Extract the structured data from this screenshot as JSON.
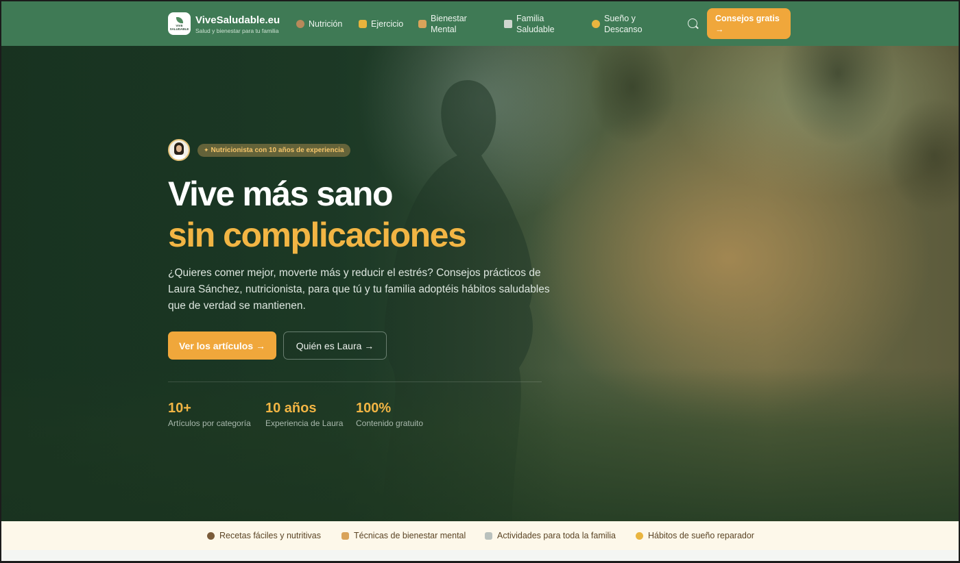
{
  "header": {
    "logo_text": "VIVE SALUDABLE",
    "brand_name": "ViveSaludable.eu",
    "brand_tagline": "Salud y bienestar para tu familia",
    "nav": [
      {
        "label": "Nutrición",
        "icon": "bowl-icon"
      },
      {
        "label": "Ejercicio",
        "icon": "flexed-arm-icon"
      },
      {
        "label": "Bienestar Mental",
        "icon": "meditation-icon"
      },
      {
        "label": "Familia Saludable",
        "icon": "family-icon"
      },
      {
        "label": "Sueño y Descanso",
        "icon": "sleeping-face-icon"
      }
    ],
    "cta_label": "Consejos gratis →"
  },
  "hero": {
    "badge": "Nutricionista con 10 años de experiencia",
    "title_line1": "Vive más sano",
    "title_line2": "sin complicaciones",
    "lead": "¿Quieres comer mejor, moverte más y reducir el estrés? Consejos prácticos de Laura Sánchez, nutricionista, para que tú y tu familia adoptéis hábitos saludables que de verdad se mantienen.",
    "primary_button": "Ver los artículos →",
    "secondary_button": "Quién es Laura →",
    "stats": [
      {
        "value": "10+",
        "label": "Artículos por categoría"
      },
      {
        "value": "10 años",
        "label": "Experiencia de Laura"
      },
      {
        "value": "100%",
        "label": "Contenido gratuito"
      }
    ]
  },
  "features": [
    {
      "label": "Recetas fáciles y nutritivas",
      "icon": "bowl-icon"
    },
    {
      "label": "Técnicas de bienestar mental",
      "icon": "meditation-icon"
    },
    {
      "label": "Actividades para toda la familia",
      "icon": "family-icon"
    },
    {
      "label": "Hábitos de sueño reparador",
      "icon": "sleeping-face-icon"
    }
  ],
  "colors": {
    "header_bg": "#3f7a55",
    "accent": "#f0a73b",
    "highlight_text": "#f2b544",
    "strip_bg": "#fdf8ea"
  }
}
